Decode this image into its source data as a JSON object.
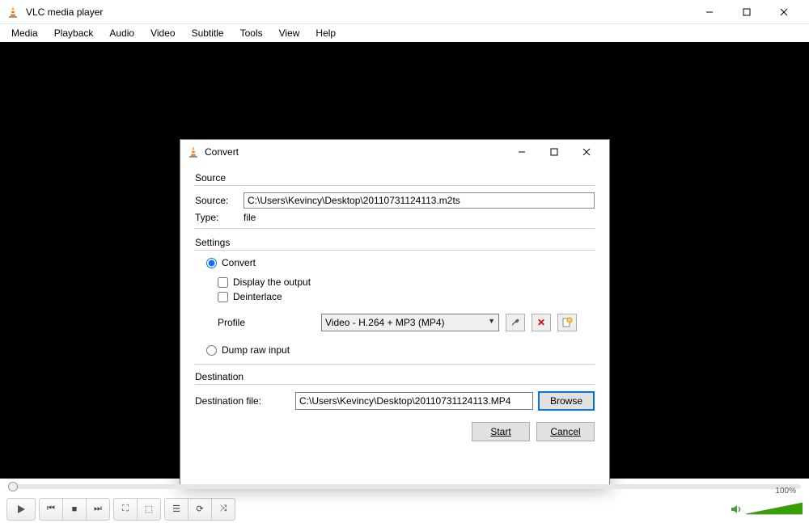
{
  "main": {
    "title": "VLC media player",
    "menu": [
      "Media",
      "Playback",
      "Audio",
      "Video",
      "Subtitle",
      "Tools",
      "View",
      "Help"
    ],
    "volume_pct": "100%"
  },
  "dialog": {
    "title": "Convert",
    "source": {
      "section": "Source",
      "label": "Source:",
      "value": "C:\\Users\\Kevincy\\Desktop\\20110731124113.m2ts",
      "type_label": "Type:",
      "type_value": "file"
    },
    "settings": {
      "section": "Settings",
      "convert": "Convert",
      "display_output": "Display the output",
      "deinterlace": "Deinterlace",
      "profile_label": "Profile",
      "profile_value": "Video - H.264 + MP3 (MP4)",
      "dump": "Dump raw input"
    },
    "destination": {
      "section": "Destination",
      "label": "Destination file:",
      "value": "C:\\Users\\Kevincy\\Desktop\\20110731124113.MP4",
      "browse": "Browse"
    },
    "buttons": {
      "start": "Start",
      "cancel": "Cancel"
    }
  }
}
